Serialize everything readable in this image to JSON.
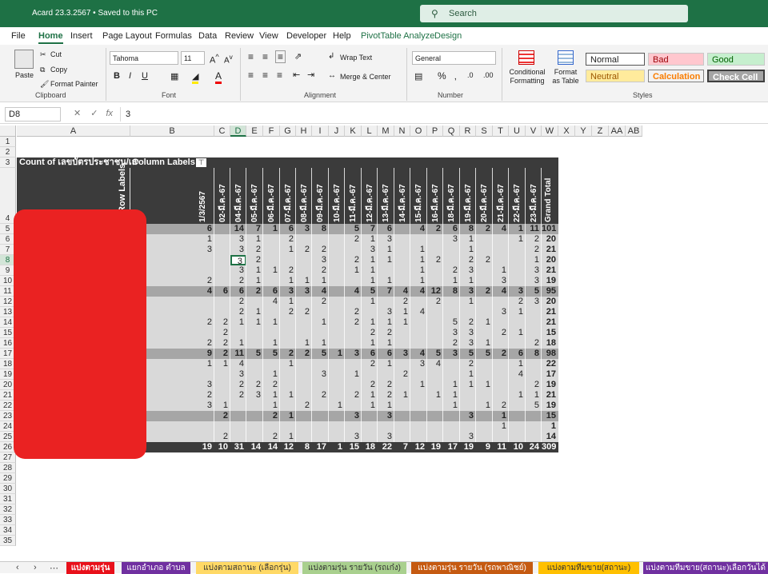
{
  "window": {
    "title": "Acard 23.3.2567  •  Saved to this PC",
    "search_placeholder": "Search"
  },
  "menu_tabs": [
    "File",
    "Home",
    "Insert",
    "Page Layout",
    "Formulas",
    "Data",
    "Review",
    "View",
    "Developer",
    "Help",
    "PivotTable Analyze",
    "Design"
  ],
  "ribbon": {
    "clipboard": {
      "paste": "Paste",
      "cut": "Cut",
      "copy": "Copy",
      "format_painter": "Format Painter",
      "label": "Clipboard"
    },
    "font": {
      "name": "Tahoma",
      "size": "11",
      "label": "Font"
    },
    "alignment": {
      "wrap_text": "Wrap Text",
      "merge_center": "Merge & Center",
      "label": "Alignment"
    },
    "number": {
      "format": "General",
      "label": "Number"
    },
    "styles": {
      "conditional": "Conditional Formatting",
      "format_table": "Format as Table",
      "label": "Styles",
      "cells": [
        "Normal",
        "Bad",
        "Good",
        "Neutral",
        "Calculation",
        "Check Cell"
      ]
    }
  },
  "formula_bar": {
    "name_box": "D8",
    "fx": "fx",
    "value": "3"
  },
  "columns": [
    "A",
    "B",
    "C",
    "D",
    "E",
    "F",
    "G",
    "H",
    "I",
    "J",
    "K",
    "L",
    "M",
    "N",
    "O",
    "P",
    "Q",
    "R",
    "S",
    "T",
    "U",
    "V",
    "W",
    "X",
    "Y",
    "Z",
    "AA",
    "AB"
  ],
  "rows": [
    "1",
    "2",
    "3",
    "4",
    "5",
    "6",
    "7",
    "8",
    "9",
    "10",
    "11",
    "12",
    "13",
    "14",
    "15",
    "16",
    "17",
    "18",
    "19",
    "20",
    "21",
    "22",
    "23",
    "24",
    "25",
    "26",
    "27",
    "28",
    "29",
    "30",
    "31",
    "32",
    "33",
    "34",
    "35"
  ],
  "pivot": {
    "title": "Count of เลขบัตรประชาชน/เลขประจำตัวผู้เสียภาษีอากร",
    "column_labels": "Column Labels",
    "row_labels": "Row Labels",
    "grand_total_label": "Grand Total",
    "date_headers": [
      "1/3/2567",
      "02-มี.ค.-67",
      "04-มี.ค.-67",
      "05-มี.ค.-67",
      "06-มี.ค.-67",
      "07-มี.ค.-67",
      "08-มี.ค.-67",
      "09-มี.ค.-67",
      "10-มี.ค.-67",
      "11-มี.ค.-67",
      "12-มี.ค.-67",
      "13-มี.ค.-67",
      "14-มี.ค.-67",
      "15-มี.ค.-67",
      "16-มี.ค.-67",
      "18-มี.ค.-67",
      "19-มี.ค.-67",
      "20-มี.ค.-67",
      "21-มี.ค.-67",
      "22-มี.ค.-67",
      "23-มี.ค.-67",
      "Grand Total"
    ],
    "rows": [
      {
        "sub": true,
        "v": [
          "6",
          "",
          "14",
          "7",
          "1",
          "6",
          "3",
          "8",
          "",
          "5",
          "7",
          "6",
          "",
          "4",
          "2",
          "6",
          "8",
          "2",
          "4",
          "1",
          "11",
          "101"
        ]
      },
      {
        "sub": false,
        "v": [
          "1",
          "",
          "3",
          "1",
          "",
          "2",
          "",
          "",
          "",
          "2",
          "1",
          "3",
          "",
          "",
          "",
          "3",
          "1",
          "",
          "",
          "1",
          "2",
          "20"
        ]
      },
      {
        "sub": false,
        "v": [
          "3",
          "",
          "3",
          "2",
          "",
          "1",
          "2",
          "2",
          "",
          "",
          "3",
          "1",
          "",
          "1",
          "",
          "",
          "1",
          "",
          "",
          "",
          "2",
          "21"
        ]
      },
      {
        "sub": false,
        "v": [
          "",
          "",
          "3",
          "2",
          "",
          "",
          "",
          "3",
          "",
          "2",
          "1",
          "1",
          "",
          "1",
          "2",
          "",
          "2",
          "2",
          "",
          "",
          "1",
          "20"
        ]
      },
      {
        "sub": false,
        "v": [
          "",
          "",
          "3",
          "1",
          "1",
          "2",
          "",
          "2",
          "",
          "1",
          "1",
          "",
          "",
          "1",
          "",
          "2",
          "3",
          "",
          "1",
          "",
          "3",
          "21"
        ]
      },
      {
        "sub": false,
        "v": [
          "2",
          "",
          "2",
          "1",
          "",
          "1",
          "1",
          "1",
          "",
          "",
          "1",
          "1",
          "",
          "1",
          "",
          "1",
          "1",
          "",
          "3",
          "",
          "3",
          "19"
        ]
      },
      {
        "sub": true,
        "v": [
          "4",
          "6",
          "6",
          "2",
          "6",
          "3",
          "3",
          "4",
          "",
          "4",
          "5",
          "7",
          "4",
          "4",
          "12",
          "8",
          "3",
          "2",
          "4",
          "3",
          "5",
          "95"
        ]
      },
      {
        "sub": false,
        "v": [
          "",
          "",
          "2",
          "",
          "4",
          "1",
          "",
          "2",
          "",
          "",
          "1",
          "",
          "2",
          "",
          "2",
          "",
          "1",
          "",
          "",
          "2",
          "3",
          "20"
        ]
      },
      {
        "sub": false,
        "v": [
          "",
          "",
          "2",
          "1",
          "",
          "2",
          "2",
          "",
          "",
          "2",
          "",
          "3",
          "1",
          "4",
          "",
          "",
          "",
          "",
          "3",
          "1",
          "",
          "21"
        ]
      },
      {
        "sub": false,
        "v": [
          "2",
          "2",
          "1",
          "1",
          "1",
          "",
          "",
          "1",
          "",
          "2",
          "1",
          "1",
          "1",
          "",
          "",
          "5",
          "2",
          "1",
          "",
          "",
          "",
          "21"
        ]
      },
      {
        "sub": false,
        "v": [
          "",
          "2",
          "",
          "",
          "",
          "",
          "",
          "",
          "",
          "",
          "2",
          "2",
          "",
          "",
          "",
          "3",
          "3",
          "",
          "2",
          "1",
          "",
          "15"
        ]
      },
      {
        "sub": false,
        "v": [
          "2",
          "2",
          "1",
          "",
          "1",
          "",
          "1",
          "1",
          "",
          "",
          "1",
          "1",
          "",
          "",
          "",
          "2",
          "3",
          "1",
          "",
          "",
          "2",
          "18"
        ]
      },
      {
        "sub": true,
        "v": [
          "9",
          "2",
          "11",
          "5",
          "5",
          "2",
          "2",
          "5",
          "1",
          "3",
          "6",
          "6",
          "3",
          "4",
          "5",
          "3",
          "5",
          "5",
          "2",
          "6",
          "8",
          "98"
        ]
      },
      {
        "sub": false,
        "v": [
          "1",
          "1",
          "4",
          "",
          "",
          "1",
          "",
          "",
          "",
          "",
          "2",
          "1",
          "",
          "3",
          "4",
          "",
          "2",
          "",
          "",
          "1",
          "",
          "22"
        ]
      },
      {
        "sub": false,
        "v": [
          "",
          "",
          "3",
          "",
          "1",
          "",
          "",
          "3",
          "",
          "1",
          "",
          "",
          "2",
          "",
          "",
          "",
          "1",
          "",
          "",
          "4",
          "",
          "17"
        ]
      },
      {
        "sub": false,
        "v": [
          "3",
          "",
          "2",
          "2",
          "2",
          "",
          "",
          "",
          "",
          "",
          "2",
          "2",
          "",
          "1",
          "",
          "1",
          "1",
          "1",
          "",
          "",
          "2",
          "19"
        ]
      },
      {
        "sub": false,
        "v": [
          "2",
          "",
          "2",
          "3",
          "1",
          "1",
          "",
          "2",
          "",
          "2",
          "1",
          "2",
          "1",
          "",
          "1",
          "1",
          "",
          "",
          "",
          "1",
          "1",
          "21"
        ]
      },
      {
        "sub": false,
        "v": [
          "3",
          "1",
          "",
          "",
          "1",
          "",
          "2",
          "",
          "1",
          "",
          "1",
          "1",
          "",
          "",
          "",
          "1",
          "",
          "1",
          "2",
          "",
          "5",
          "19"
        ]
      },
      {
        "sub": true,
        "v": [
          "",
          "2",
          "",
          "",
          "2",
          "1",
          "",
          "",
          "",
          "3",
          "",
          "3",
          "",
          "",
          "",
          "",
          "3",
          "",
          "1",
          "",
          "",
          "15"
        ]
      },
      {
        "sub": false,
        "v": [
          "",
          "",
          "",
          "",
          "",
          "",
          "",
          "",
          "",
          "",
          "",
          "",
          "",
          "",
          "",
          "",
          "",
          "",
          "1",
          "",
          "",
          "1"
        ]
      },
      {
        "sub": false,
        "v": [
          "",
          "2",
          "",
          "",
          "2",
          "1",
          "",
          "",
          "",
          "3",
          "",
          "3",
          "",
          "",
          "",
          "",
          "3",
          "",
          "",
          "",
          "",
          "14"
        ]
      }
    ],
    "grand_row": [
      "19",
      "10",
      "31",
      "14",
      "14",
      "12",
      "8",
      "17",
      "1",
      "15",
      "18",
      "22",
      "7",
      "12",
      "19",
      "17",
      "19",
      "9",
      "11",
      "10",
      "24",
      "309"
    ]
  },
  "sheet_tabs": [
    {
      "name": "แบ่งตามรุ่น",
      "bg": "#e8101a",
      "fg": "#ffffff"
    },
    {
      "name": "แยกอำเภอ ตำบล",
      "bg": "#7030a0",
      "fg": "#ffffff"
    },
    {
      "name": "แบ่งตามสถานะ (เลือกรุ่น)",
      "bg": "#ffd966",
      "fg": "#333333"
    },
    {
      "name": "แบ่งตามรุ่น รายวัน (รถเก๋ง)",
      "bg": "#a9d08e",
      "fg": "#333333"
    },
    {
      "name": "แบ่งตามรุ่น รายวัน (รถพาณิชย์)",
      "bg": "#c55a11",
      "fg": "#ffffff"
    },
    {
      "name": "แบ่งตามทีมขาย(สถานะ)",
      "bg": "#ffc000",
      "fg": "#333333"
    },
    {
      "name": "แบ่งตามทีมขาย(สถานะ)เลือกวันได้",
      "bg": "#7030a0",
      "fg": "#ffffff"
    }
  ],
  "colors": {
    "excel_green": "#1e7145",
    "pivot_header": "#3b3b3b",
    "subtotal": "#a6a6a6",
    "row": "#d9d9d9"
  }
}
